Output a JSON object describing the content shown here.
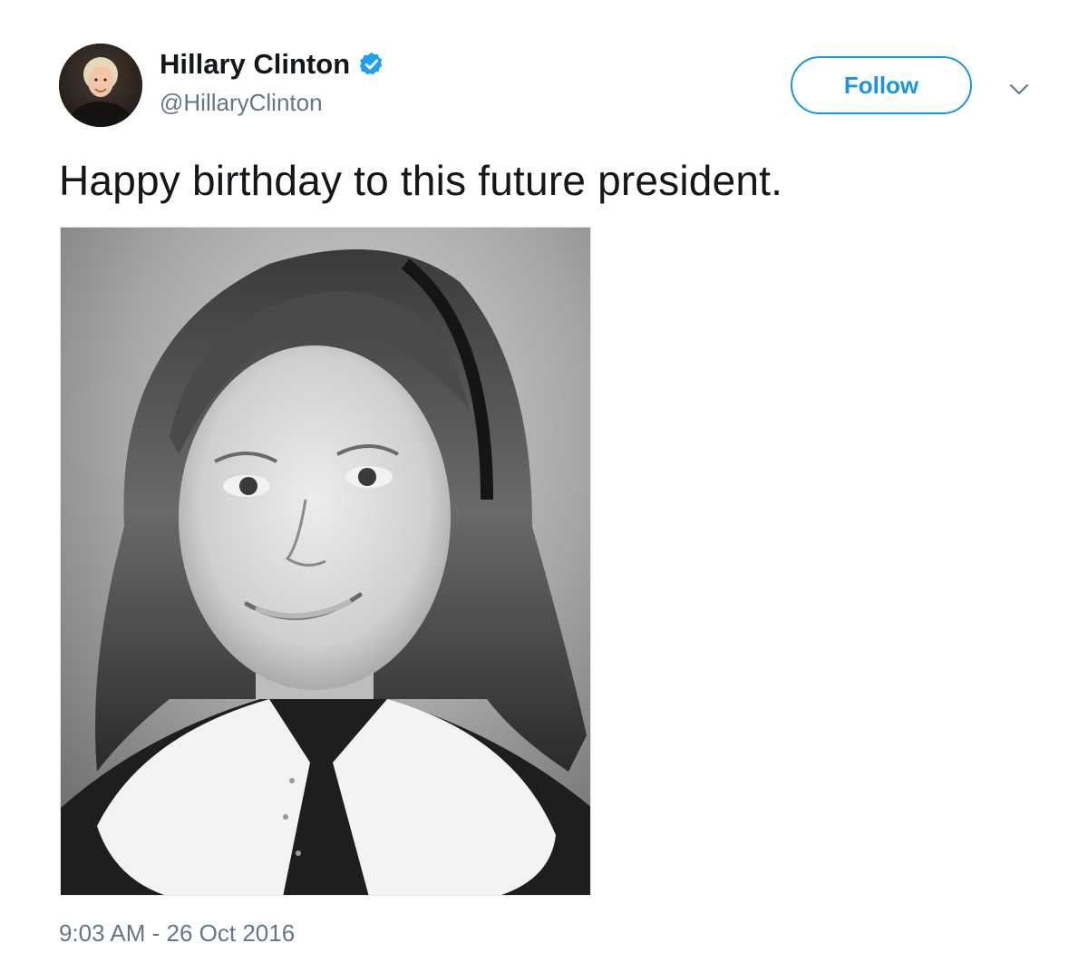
{
  "author": {
    "display_name": "Hillary Clinton",
    "handle": "@HillaryClinton",
    "verified": true,
    "avatar_icon": "profile-photo"
  },
  "actions": {
    "follow_label": "Follow",
    "menu_icon": "chevron-down-icon"
  },
  "tweet": {
    "text": "Happy birthday to this future president.",
    "media_icon": "childhood-portrait-photo",
    "timestamp": "9:03 AM - 26 Oct 2016"
  },
  "colors": {
    "accent": "#1b95e0",
    "text_primary": "#14171a",
    "text_secondary": "#657786",
    "background": "#ffffff"
  }
}
